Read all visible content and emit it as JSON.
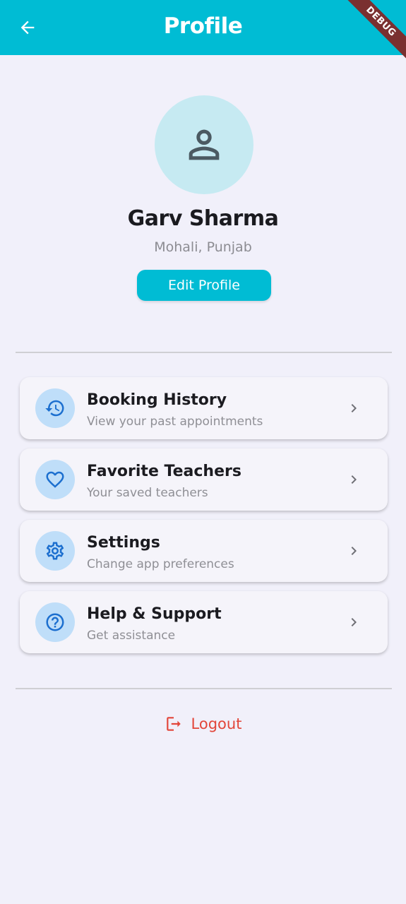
{
  "appbar": {
    "title": "Profile",
    "back_icon": "arrow-left-icon",
    "debug_banner": "DEBUG",
    "color": "#00bcd4"
  },
  "profile": {
    "avatar_icon": "person-icon",
    "name": "Garv Sharma",
    "location": "Mohali, Punjab",
    "edit_label": "Edit Profile"
  },
  "menu": {
    "items": [
      {
        "icon": "history-icon",
        "title": "Booking History",
        "subtitle": "View your past appointments"
      },
      {
        "icon": "heart-icon",
        "title": "Favorite Teachers",
        "subtitle": "Your saved teachers"
      },
      {
        "icon": "gear-icon",
        "title": "Settings",
        "subtitle": "Change app preferences"
      },
      {
        "icon": "help-icon",
        "title": "Help & Support",
        "subtitle": "Get assistance"
      }
    ]
  },
  "logout": {
    "label": "Logout",
    "icon": "logout-icon",
    "color": "#e2463a"
  },
  "colors": {
    "accent": "#00bcd4",
    "icon_blue": "#1c6fcf",
    "icon_bg": "#bfdef9",
    "background": "#f1f0fa"
  }
}
